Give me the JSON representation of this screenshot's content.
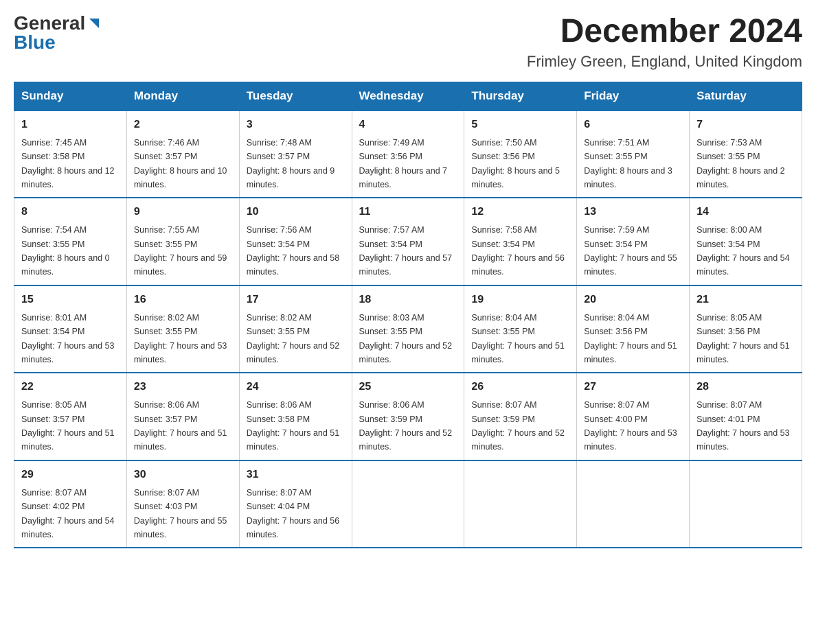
{
  "header": {
    "logo_general": "General",
    "logo_blue": "Blue",
    "month_title": "December 2024",
    "location": "Frimley Green, England, United Kingdom"
  },
  "weekdays": [
    "Sunday",
    "Monday",
    "Tuesday",
    "Wednesday",
    "Thursday",
    "Friday",
    "Saturday"
  ],
  "weeks": [
    [
      {
        "day": "1",
        "sunrise": "7:45 AM",
        "sunset": "3:58 PM",
        "daylight": "8 hours and 12 minutes."
      },
      {
        "day": "2",
        "sunrise": "7:46 AM",
        "sunset": "3:57 PM",
        "daylight": "8 hours and 10 minutes."
      },
      {
        "day": "3",
        "sunrise": "7:48 AM",
        "sunset": "3:57 PM",
        "daylight": "8 hours and 9 minutes."
      },
      {
        "day": "4",
        "sunrise": "7:49 AM",
        "sunset": "3:56 PM",
        "daylight": "8 hours and 7 minutes."
      },
      {
        "day": "5",
        "sunrise": "7:50 AM",
        "sunset": "3:56 PM",
        "daylight": "8 hours and 5 minutes."
      },
      {
        "day": "6",
        "sunrise": "7:51 AM",
        "sunset": "3:55 PM",
        "daylight": "8 hours and 3 minutes."
      },
      {
        "day": "7",
        "sunrise": "7:53 AM",
        "sunset": "3:55 PM",
        "daylight": "8 hours and 2 minutes."
      }
    ],
    [
      {
        "day": "8",
        "sunrise": "7:54 AM",
        "sunset": "3:55 PM",
        "daylight": "8 hours and 0 minutes."
      },
      {
        "day": "9",
        "sunrise": "7:55 AM",
        "sunset": "3:55 PM",
        "daylight": "7 hours and 59 minutes."
      },
      {
        "day": "10",
        "sunrise": "7:56 AM",
        "sunset": "3:54 PM",
        "daylight": "7 hours and 58 minutes."
      },
      {
        "day": "11",
        "sunrise": "7:57 AM",
        "sunset": "3:54 PM",
        "daylight": "7 hours and 57 minutes."
      },
      {
        "day": "12",
        "sunrise": "7:58 AM",
        "sunset": "3:54 PM",
        "daylight": "7 hours and 56 minutes."
      },
      {
        "day": "13",
        "sunrise": "7:59 AM",
        "sunset": "3:54 PM",
        "daylight": "7 hours and 55 minutes."
      },
      {
        "day": "14",
        "sunrise": "8:00 AM",
        "sunset": "3:54 PM",
        "daylight": "7 hours and 54 minutes."
      }
    ],
    [
      {
        "day": "15",
        "sunrise": "8:01 AM",
        "sunset": "3:54 PM",
        "daylight": "7 hours and 53 minutes."
      },
      {
        "day": "16",
        "sunrise": "8:02 AM",
        "sunset": "3:55 PM",
        "daylight": "7 hours and 53 minutes."
      },
      {
        "day": "17",
        "sunrise": "8:02 AM",
        "sunset": "3:55 PM",
        "daylight": "7 hours and 52 minutes."
      },
      {
        "day": "18",
        "sunrise": "8:03 AM",
        "sunset": "3:55 PM",
        "daylight": "7 hours and 52 minutes."
      },
      {
        "day": "19",
        "sunrise": "8:04 AM",
        "sunset": "3:55 PM",
        "daylight": "7 hours and 51 minutes."
      },
      {
        "day": "20",
        "sunrise": "8:04 AM",
        "sunset": "3:56 PM",
        "daylight": "7 hours and 51 minutes."
      },
      {
        "day": "21",
        "sunrise": "8:05 AM",
        "sunset": "3:56 PM",
        "daylight": "7 hours and 51 minutes."
      }
    ],
    [
      {
        "day": "22",
        "sunrise": "8:05 AM",
        "sunset": "3:57 PM",
        "daylight": "7 hours and 51 minutes."
      },
      {
        "day": "23",
        "sunrise": "8:06 AM",
        "sunset": "3:57 PM",
        "daylight": "7 hours and 51 minutes."
      },
      {
        "day": "24",
        "sunrise": "8:06 AM",
        "sunset": "3:58 PM",
        "daylight": "7 hours and 51 minutes."
      },
      {
        "day": "25",
        "sunrise": "8:06 AM",
        "sunset": "3:59 PM",
        "daylight": "7 hours and 52 minutes."
      },
      {
        "day": "26",
        "sunrise": "8:07 AM",
        "sunset": "3:59 PM",
        "daylight": "7 hours and 52 minutes."
      },
      {
        "day": "27",
        "sunrise": "8:07 AM",
        "sunset": "4:00 PM",
        "daylight": "7 hours and 53 minutes."
      },
      {
        "day": "28",
        "sunrise": "8:07 AM",
        "sunset": "4:01 PM",
        "daylight": "7 hours and 53 minutes."
      }
    ],
    [
      {
        "day": "29",
        "sunrise": "8:07 AM",
        "sunset": "4:02 PM",
        "daylight": "7 hours and 54 minutes."
      },
      {
        "day": "30",
        "sunrise": "8:07 AM",
        "sunset": "4:03 PM",
        "daylight": "7 hours and 55 minutes."
      },
      {
        "day": "31",
        "sunrise": "8:07 AM",
        "sunset": "4:04 PM",
        "daylight": "7 hours and 56 minutes."
      },
      null,
      null,
      null,
      null
    ]
  ]
}
